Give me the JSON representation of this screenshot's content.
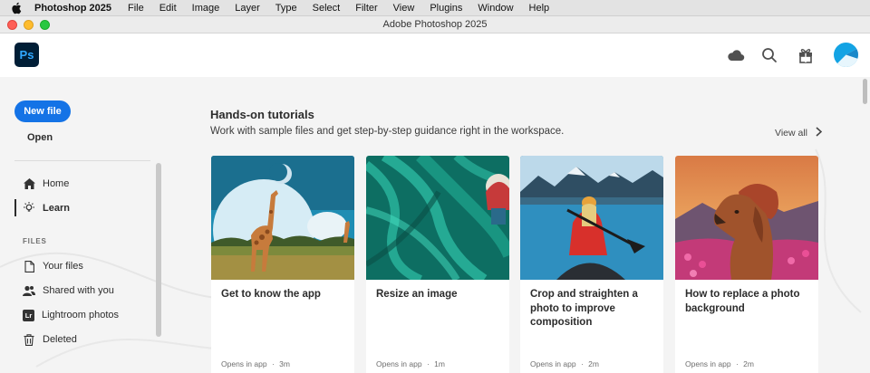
{
  "menubar": {
    "app_name": "Photoshop 2025",
    "items": [
      "File",
      "Edit",
      "Image",
      "Layer",
      "Type",
      "Select",
      "Filter",
      "View",
      "Plugins",
      "Window",
      "Help"
    ]
  },
  "window": {
    "title": "Adobe Photoshop 2025"
  },
  "header": {
    "logo_text": "Ps",
    "icons": [
      "cloud-icon",
      "search-icon",
      "gift-icon",
      "avatar"
    ]
  },
  "sidebar": {
    "new_file": "New file",
    "open": "Open",
    "nav": [
      {
        "label": "Home",
        "icon": "home-icon"
      },
      {
        "label": "Learn",
        "icon": "lightbulb-icon",
        "active": true
      }
    ],
    "files_heading": "FILES",
    "files": [
      {
        "label": "Your files",
        "icon": "file-icon"
      },
      {
        "label": "Shared with you",
        "icon": "shared-users-icon"
      },
      {
        "label": "Lightroom photos",
        "icon": "lightroom-icon"
      },
      {
        "label": "Deleted",
        "icon": "trash-icon"
      }
    ],
    "lightroom_badge": "Lr"
  },
  "main": {
    "section_title": "Hands-on tutorials",
    "section_subtitle": "Work with sample files and get step-by-step guidance right in the workspace.",
    "view_all": "View all",
    "cards": [
      {
        "title": "Get to know the app",
        "opens": "Opens in app",
        "sep": "·",
        "duration": "3m"
      },
      {
        "title": "Resize an image",
        "opens": "Opens in app",
        "sep": "·",
        "duration": "1m"
      },
      {
        "title": "Crop and straighten a photo to improve composition",
        "opens": "Opens in app",
        "sep": "·",
        "duration": "2m"
      },
      {
        "title": "How to replace a photo background",
        "opens": "Opens in app",
        "sep": "·",
        "duration": "2m"
      }
    ]
  },
  "colors": {
    "accent": "#1473e6",
    "ps_logo_bg": "#001e36",
    "ps_logo_fg": "#31a8ff",
    "avatar": "#13a3e4"
  }
}
